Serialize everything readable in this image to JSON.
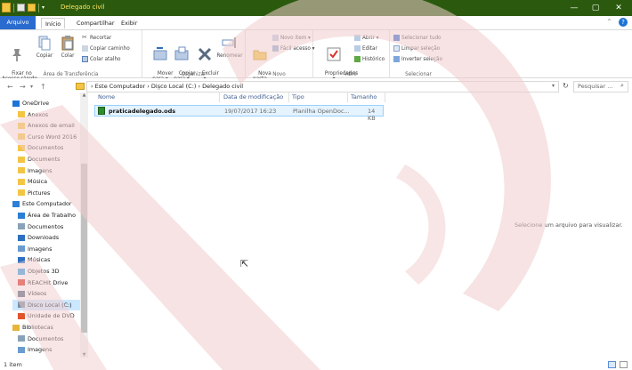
{
  "window": {
    "title": "Delegado civil"
  },
  "tabs": [
    {
      "label": "Arquivo",
      "kind": "file"
    },
    {
      "label": "Início",
      "kind": "active"
    },
    {
      "label": "Compartilhar",
      "kind": "normal"
    },
    {
      "label": "Exibir",
      "kind": "normal"
    }
  ],
  "ribbon": {
    "clipboard": {
      "group_label": "Área de Transferência",
      "pin": "Fixar no\nAcesso rápido",
      "copy": "Copiar",
      "paste": "Colar",
      "cut": "Recortar",
      "copy_path": "Copiar caminho",
      "paste_shortcut": "Colar atalho"
    },
    "organize": {
      "group_label": "Organizar",
      "move": "Mover\npara ▾",
      "copy_to": "Copiar\npara ▾",
      "delete": "Excluir\n▾",
      "rename": "Renomear"
    },
    "new": {
      "group_label": "Novo",
      "new_folder": "Nova\npasta",
      "new_item": "Novo item ▾",
      "easy_access": "Fácil acesso ▾"
    },
    "open": {
      "group_label": "Abrir",
      "properties": "Propriedades\n▾",
      "open": "Abrir ▾",
      "edit": "Editar",
      "history": "Histórico"
    },
    "select": {
      "group_label": "Selecionar",
      "select_all": "Selecionar tudo",
      "select_none": "Limpar seleção",
      "invert": "Inverter seleção"
    }
  },
  "address": {
    "path": "›  Este Computador  ›  Disco Local (C:)  ›  Delegado civil",
    "search_placeholder": "Pesquisar ..."
  },
  "sidebar": [
    {
      "label": "OneDrive",
      "icon": "cloud-icon",
      "color": "#1e73d6",
      "indent": 0
    },
    {
      "label": "Anexos",
      "icon": "folder-icon",
      "color": "#f3c544",
      "indent": 1
    },
    {
      "label": "Anexos de email",
      "icon": "folder-icon",
      "color": "#f3c544",
      "indent": 1
    },
    {
      "label": "Curso Word 2016",
      "icon": "folder-icon",
      "color": "#f3c544",
      "indent": 1
    },
    {
      "label": "Documentos",
      "icon": "folder-icon",
      "color": "#f3c544",
      "indent": 1
    },
    {
      "label": "Documents",
      "icon": "folder-icon",
      "color": "#f3c544",
      "indent": 1
    },
    {
      "label": "Imagens",
      "icon": "folder-icon",
      "color": "#f3c544",
      "indent": 1
    },
    {
      "label": "Música",
      "icon": "folder-icon",
      "color": "#f3c544",
      "indent": 1
    },
    {
      "label": "Pictures",
      "icon": "folder-icon",
      "color": "#f3c544",
      "indent": 1
    },
    {
      "label": "Este Computador",
      "icon": "computer-icon",
      "color": "#2d7fd5",
      "indent": 0
    },
    {
      "label": "Área de Trabalho",
      "icon": "desktop-icon",
      "color": "#2d7fd5",
      "indent": 1
    },
    {
      "label": "Documentos",
      "icon": "documents-icon",
      "color": "#8aa2b8",
      "indent": 1
    },
    {
      "label": "Downloads",
      "icon": "download-icon",
      "color": "#2d6fc1",
      "indent": 1
    },
    {
      "label": "Imagens",
      "icon": "pictures-icon",
      "color": "#6a9bd0",
      "indent": 1
    },
    {
      "label": "Músicas",
      "icon": "music-icon",
      "color": "#2d6fc1",
      "indent": 1
    },
    {
      "label": "Objetos 3D",
      "icon": "cube-icon",
      "color": "#3ba0e0",
      "indent": 1
    },
    {
      "label": "REACHit Drive",
      "icon": "drive-icon",
      "color": "#d9342b",
      "indent": 1
    },
    {
      "label": "Vídeos",
      "icon": "video-icon",
      "color": "#556b80",
      "indent": 1
    },
    {
      "label": "Disco Local (C:)",
      "icon": "disk-icon",
      "color": "#7a8fa3",
      "indent": 1,
      "selected": true
    },
    {
      "label": "Unidade de DVD",
      "icon": "dvd-icon",
      "color": "#e1532b",
      "indent": 1
    },
    {
      "label": "Bibliotecas",
      "icon": "library-icon",
      "color": "#e7b53a",
      "indent": 0
    },
    {
      "label": "Documentos",
      "icon": "documents-icon",
      "color": "#8aa2b8",
      "indent": 1
    },
    {
      "label": "Imagens",
      "icon": "pictures-icon",
      "color": "#6a9bd0",
      "indent": 1
    }
  ],
  "columns": {
    "name": "Nome",
    "date": "Data de modificação",
    "type": "Tipo",
    "size": "Tamanho"
  },
  "files": [
    {
      "name": "praticadelegado.ods",
      "date": "19/07/2017 16:23",
      "type": "Planilha OpenDoc...",
      "size": "14 KB"
    }
  ],
  "preview_text": "Selecione um arquivo para visualizar.",
  "status": {
    "count": "1 item"
  },
  "colors": {
    "titlebar": "#2b5a0e",
    "accent": "#2a6bd0",
    "selection": "#cce8ff"
  }
}
